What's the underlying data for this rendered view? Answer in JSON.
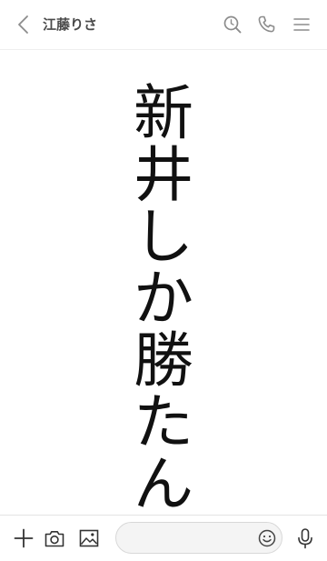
{
  "header": {
    "title": "江藤りさ",
    "icons": {
      "back": "chevron-left-icon",
      "search": "search-icon",
      "call": "phone-icon",
      "menu": "hamburger-menu-icon"
    }
  },
  "message": {
    "chars": [
      "新",
      "井",
      "し",
      "か",
      "勝",
      "た",
      "ん"
    ]
  },
  "input_bar": {
    "placeholder": "",
    "icons": {
      "add": "plus-icon",
      "camera": "camera-icon",
      "image": "image-icon",
      "emoji": "smiley-icon",
      "mic": "microphone-icon"
    }
  },
  "colors": {
    "header_icon": "#8c8c8c",
    "title_text": "#4a4a4a",
    "message_text": "#111111",
    "input_bg": "#f4f4f4"
  }
}
